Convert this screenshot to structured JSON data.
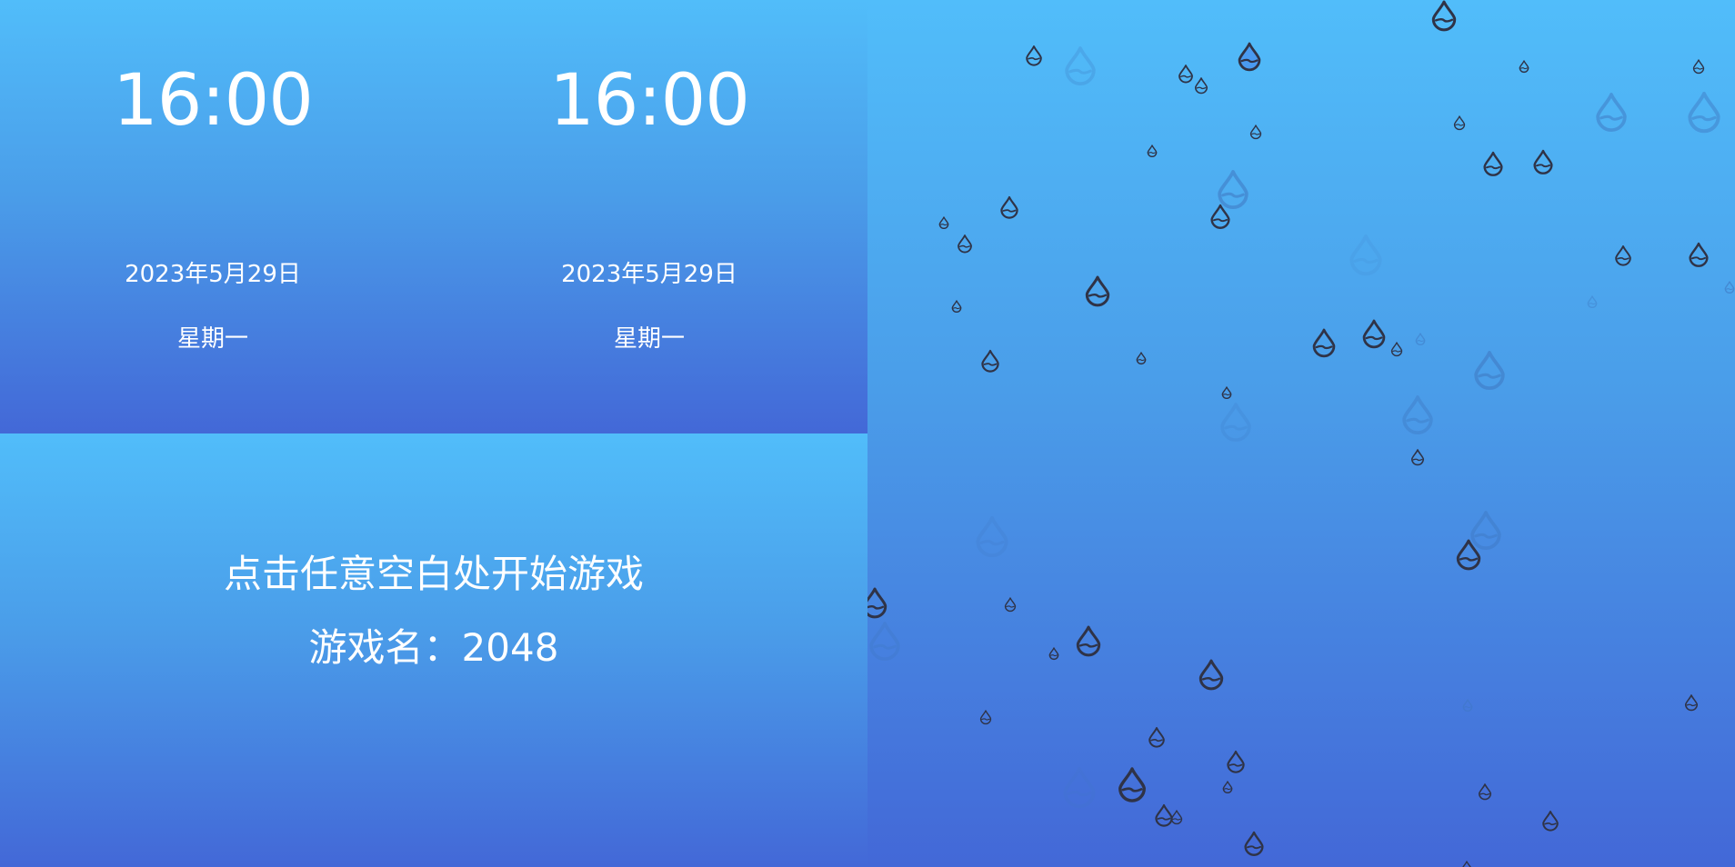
{
  "clocks": [
    {
      "time": "16:00",
      "date": "2023年5月29日",
      "weekday": "星期一"
    },
    {
      "time": "16:00",
      "date": "2023年5月29日",
      "weekday": "星期一"
    }
  ],
  "game": {
    "start_hint": "点击任意空白处开始游戏",
    "game_name_line": "游戏名：2048"
  },
  "rain": {
    "icon": "water-drop-icon",
    "drop_color": "#2f3347",
    "faint_drop_color": "#3f78c2",
    "drop_fill": "#4a9af0"
  },
  "colors": {
    "gradient_top": "#51bdfa",
    "gradient_bottom": "#4368d7",
    "text": "#ffffff"
  }
}
